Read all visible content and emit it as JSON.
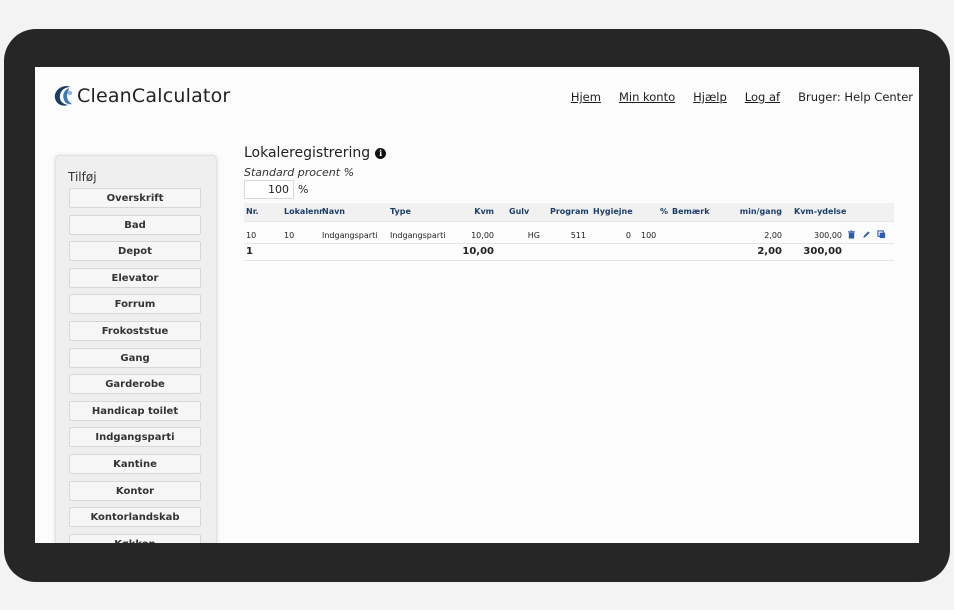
{
  "app": {
    "name": "CleanCalculator"
  },
  "nav": {
    "home": "Hjem",
    "account": "Min konto",
    "help": "Hjælp",
    "logout": "Log af",
    "user": "Bruger: Help Center"
  },
  "sidebar": {
    "title": "Tilføj",
    "items": [
      "Overskrift",
      "Bad",
      "Depot",
      "Elevator",
      "Forrum",
      "Frokoststue",
      "Gang",
      "Garderobe",
      "Handicap toilet",
      "Indgangsparti",
      "Kantine",
      "Kontor",
      "Kontorlandskab",
      "Køkken"
    ]
  },
  "main": {
    "title": "Lokaleregistrering",
    "standard_label": "Standard procent %",
    "standard_value": "100",
    "standard_unit": "%"
  },
  "table": {
    "headers": {
      "nr": "Nr.",
      "lokalenr": "Lokalenr",
      "navn": "Navn",
      "type": "Type",
      "kvm": "Kvm",
      "gulv": "Gulv",
      "program": "Program",
      "hygiejne": "Hygiejne",
      "pct": "%",
      "bemaerk": "Bemærk",
      "mingang": "min/gang",
      "kvmydelse": "Kvm-ydelse"
    },
    "row": {
      "nr": "10",
      "lokalenr": "10",
      "navn": "Indgangsparti",
      "type": "Indgangsparti",
      "kvm": "10,00",
      "gulv": "HG",
      "program": "511",
      "hygiejne": "0",
      "pct": "100",
      "bemaerk": "",
      "mingang": "2,00",
      "kvmydelse": "300,00"
    },
    "total": {
      "count": "1",
      "kvm": "10,00",
      "mingang": "2,00",
      "kvmydelse": "300,00"
    }
  },
  "colors": {
    "header_text": "#1c3f6a",
    "frame": "#262626",
    "icon_blue": "#2a5db0"
  }
}
